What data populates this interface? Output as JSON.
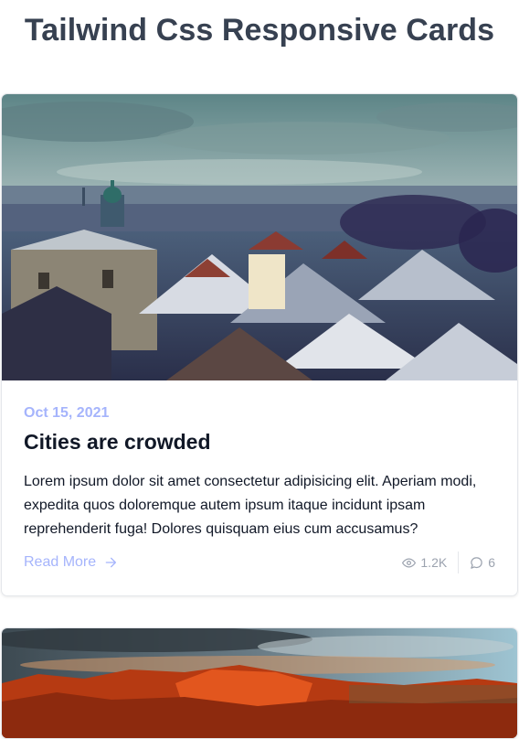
{
  "page": {
    "title": "Tailwind Css Responsive Cards"
  },
  "cards": [
    {
      "date": "Oct 15, 2021",
      "title": "Cities are crowded",
      "text": "Lorem ipsum dolor sit amet consectetur adipisicing elit. Aperiam modi, expedita quos doloremque autem ipsum itaque incidunt ipsam reprehenderit fuga! Dolores quisquam eius cum accusamus?",
      "read_more": "Read More",
      "views": "1.2K",
      "comments": "6",
      "image": "snowy-city-rooftops-photo"
    },
    {
      "image": "red-rock-canyon-sunset-photo"
    }
  ],
  "icons": {
    "read_more": "arrow-right-icon",
    "views": "eye-icon",
    "comments": "chat-bubble-icon"
  },
  "colors": {
    "title": "#374151",
    "accent": "#a5b4fc",
    "muted": "#9ca3af",
    "border": "#e5e7eb"
  }
}
